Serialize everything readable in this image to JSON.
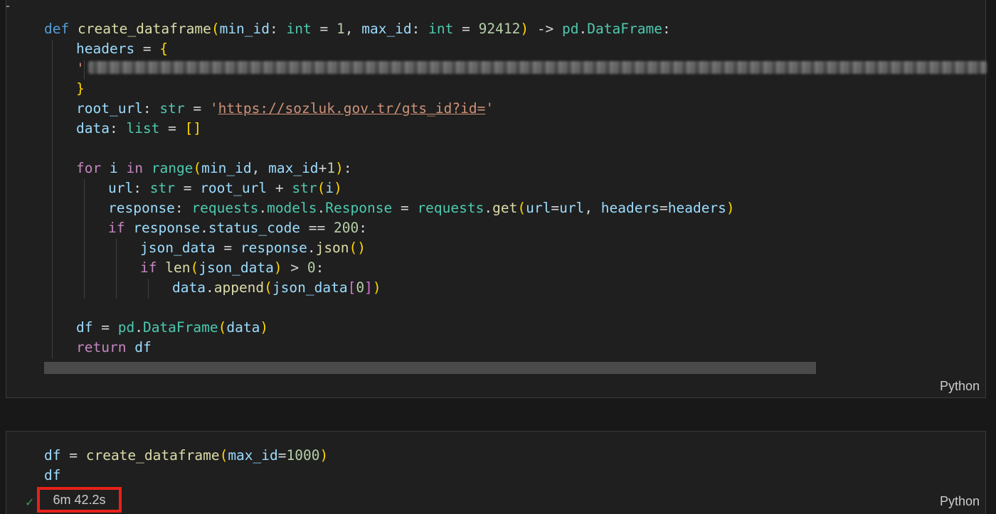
{
  "cell1": {
    "language": "Python",
    "lines": {
      "l1": {
        "def": "def",
        "fname": "create_dataframe",
        "p1": "min_id",
        "c1": ": ",
        "t1": "int",
        "eq1": " = ",
        "v1": "1",
        "comma": ", ",
        "p2": "max_id",
        "c2": ": ",
        "t2": "int",
        "eq2": " = ",
        "v2": "92412",
        "arrow": " -> ",
        "pd": "pd",
        "dot": ".",
        "ret": "DataFrame",
        "colon": ":"
      },
      "l2": {
        "name": "headers",
        "eq": " = ",
        "brace": "{"
      },
      "l3": {
        "quote": "'"
      },
      "l4": {
        "brace": "}"
      },
      "l5": {
        "name": "root_url",
        "colon": ": ",
        "type": "str",
        "eq": " = ",
        "q1": "'",
        "url": "https://sozluk.gov.tr/gts_id?id=",
        "q2": "'"
      },
      "l6": {
        "name": "data",
        "colon": ": ",
        "type": "list",
        "eq": " = ",
        "br": "[]"
      },
      "l7": {
        "for": "for",
        "sp1": " ",
        "i": "i",
        "sp2": " ",
        "in": "in",
        "sp3": " ",
        "range": "range",
        "p": "(",
        "a1": "min_id",
        "comma": ", ",
        "a2": "max_id",
        "plus": "+",
        "one": "1",
        "pc": ")",
        "colon": ":"
      },
      "l8": {
        "name": "url",
        "colon": ": ",
        "type": "str",
        "eq": " = ",
        "root": "root_url",
        "plus": " + ",
        "str": "str",
        "p": "(",
        "i": "i",
        "pc": ")"
      },
      "l9": {
        "name": "response",
        "colon": ": ",
        "m1": "requests",
        "d1": ".",
        "m2": "models",
        "d2": ".",
        "cls": "Response",
        "eq": " = ",
        "m3": "requests",
        "d3": ".",
        "get": "get",
        "p": "(",
        "k1": "url",
        "e1": "=",
        "v1": "url",
        "comma": ", ",
        "k2": "headers",
        "e2": "=",
        "v2": "headers",
        "pc": ")"
      },
      "l10": {
        "if": "if",
        "sp": " ",
        "obj": "response",
        "dot": ".",
        "attr": "status_code",
        "op": " == ",
        "num": "200",
        "colon": ":"
      },
      "l11": {
        "name": "json_data",
        "eq": " = ",
        "obj": "response",
        "dot": ".",
        "fn": "json",
        "p": "()"
      },
      "l12": {
        "if": "if",
        "sp": " ",
        "len": "len",
        "p": "(",
        "arg": "json_data",
        "pc": ")",
        "op": " > ",
        "num": "0",
        "colon": ":"
      },
      "l13": {
        "obj": "data",
        "dot": ".",
        "fn": "append",
        "p": "(",
        "arg": "json_data",
        "sb": "[",
        "idx": "0",
        "sbc": "]",
        "pc": ")"
      },
      "l14": {
        "name": "df",
        "eq": " = ",
        "pd": "pd",
        "dot": ".",
        "cls": "DataFrame",
        "p": "(",
        "arg": "data",
        "pc": ")"
      },
      "l15": {
        "ret": "return",
        "sp": " ",
        "val": "df"
      }
    }
  },
  "cell2": {
    "language": "Python",
    "status_icon": "check-icon",
    "exec_time": "6m 42.2s",
    "lines": {
      "l1": {
        "name": "df",
        "eq": " = ",
        "fn": "create_dataframe",
        "p": "(",
        "k": "max_id",
        "e": "=",
        "v": "1000",
        "pc": ")"
      },
      "l2": {
        "name": "df"
      }
    }
  },
  "colors": {
    "background": "#181818",
    "cell_bg": "#1f1f1f",
    "keyword": "#569cd6",
    "control": "#c586c0",
    "function": "#dcdcaa",
    "variable": "#9cdcfe",
    "type": "#4ec9b0",
    "number": "#b5cea8",
    "string": "#ce9178",
    "highlight_box": "#e8211a",
    "success": "#3c9a5f"
  }
}
